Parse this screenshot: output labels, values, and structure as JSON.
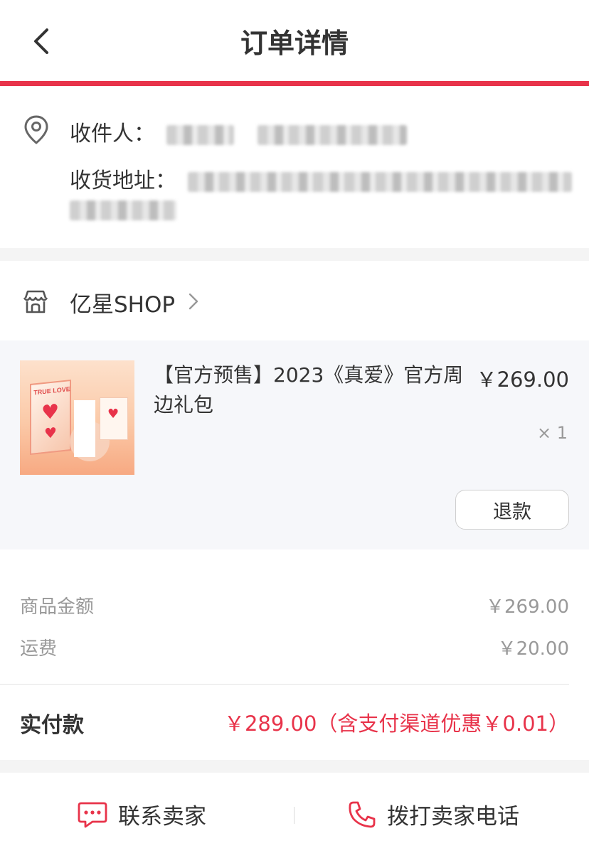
{
  "header": {
    "title": "订单详情",
    "back_icon": "chevron-left-icon"
  },
  "accent_color": "#e8334a",
  "address": {
    "icon": "location-pin-icon",
    "recipient_label": "收件人：",
    "address_label": "收货地址："
  },
  "shop": {
    "icon": "store-icon",
    "name": "亿星SHOP",
    "chevron_icon": "chevron-right-icon"
  },
  "product": {
    "image_text": "TRUE LOVE",
    "title": "【官方预售】2023《真爱》官方周边礼包",
    "price": "￥269.00",
    "quantity": "× 1",
    "refund_label": "退款"
  },
  "summary": {
    "goods_label": "商品金额",
    "goods_value": "￥269.00",
    "shipping_label": "运费",
    "shipping_value": "￥20.00",
    "paid_label": "实付款",
    "paid_value": "￥289.00（含支付渠道优惠￥0.01）"
  },
  "footer": {
    "contact_label": "联系卖家",
    "contact_icon": "chat-icon",
    "call_label": "拨打卖家电话",
    "call_icon": "phone-icon"
  }
}
